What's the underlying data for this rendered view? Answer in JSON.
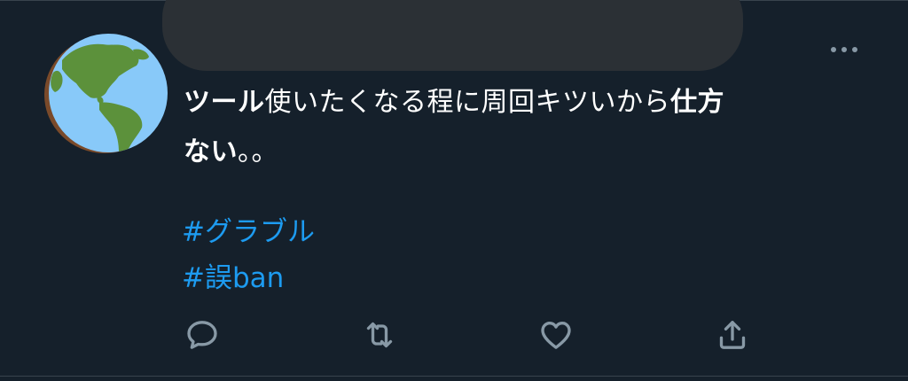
{
  "tweet": {
    "text_segments": [
      {
        "text": "ツール",
        "bold": true
      },
      {
        "text": "使いたくなる程に周回キツいから",
        "bold": false
      },
      {
        "text": "仕方",
        "bold": true
      },
      {
        "text": "ない",
        "bold": true
      },
      {
        "text": "。。",
        "bold": false
      }
    ],
    "hashtags": [
      "#グラブル",
      "#誤ban"
    ]
  },
  "avatar": {
    "icon": "globe-americas-icon"
  },
  "colors": {
    "background": "#15202b",
    "text": "#ffffff",
    "link": "#1d9bf0",
    "icon": "#8899a6",
    "redaction": "#2b3035"
  },
  "actions": [
    {
      "name": "reply",
      "icon": "speech-bubble-icon"
    },
    {
      "name": "retweet",
      "icon": "retweet-icon"
    },
    {
      "name": "like",
      "icon": "heart-icon"
    },
    {
      "name": "share",
      "icon": "share-icon"
    }
  ]
}
